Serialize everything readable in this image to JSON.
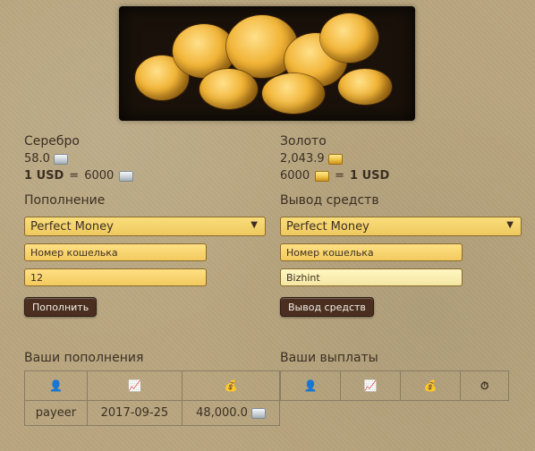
{
  "left": {
    "section_title": "Серебро",
    "balance": "58.0",
    "rate_left": "1 USD",
    "rate_equals": "=",
    "rate_right": "6000",
    "fund_title": "Пополнение",
    "select_value": "Perfect Money",
    "wallet_placeholder": "Номер кошелька",
    "amount_value": "12",
    "button_label": "Пополнить",
    "history_title": "Ваши пополнения",
    "table_headers": [
      "user-icon",
      "chart-icon",
      "money-bag-icon"
    ],
    "rows": [
      {
        "system": "payeer",
        "date": "2017-09-25",
        "amount": "48,000.0"
      }
    ]
  },
  "right": {
    "section_title": "Золото",
    "balance": "2,043.9",
    "rate_left": "6000",
    "rate_equals": "=",
    "rate_right": "1 USD",
    "withdraw_title": "Вывод средств",
    "select_value": "Perfect Money",
    "wallet_placeholder": "Номер кошелька",
    "wallet_value": "Bizhint",
    "button_label": "Вывод средств",
    "payout_title": "Ваши выплаты",
    "table_headers": [
      "user-icon",
      "chart-icon",
      "money-bag-icon",
      "clock-money-icon"
    ]
  },
  "colors": {
    "accent_gold": "#f1c84a",
    "brown_button": "#4a2f20",
    "bg": "#b9a680"
  }
}
